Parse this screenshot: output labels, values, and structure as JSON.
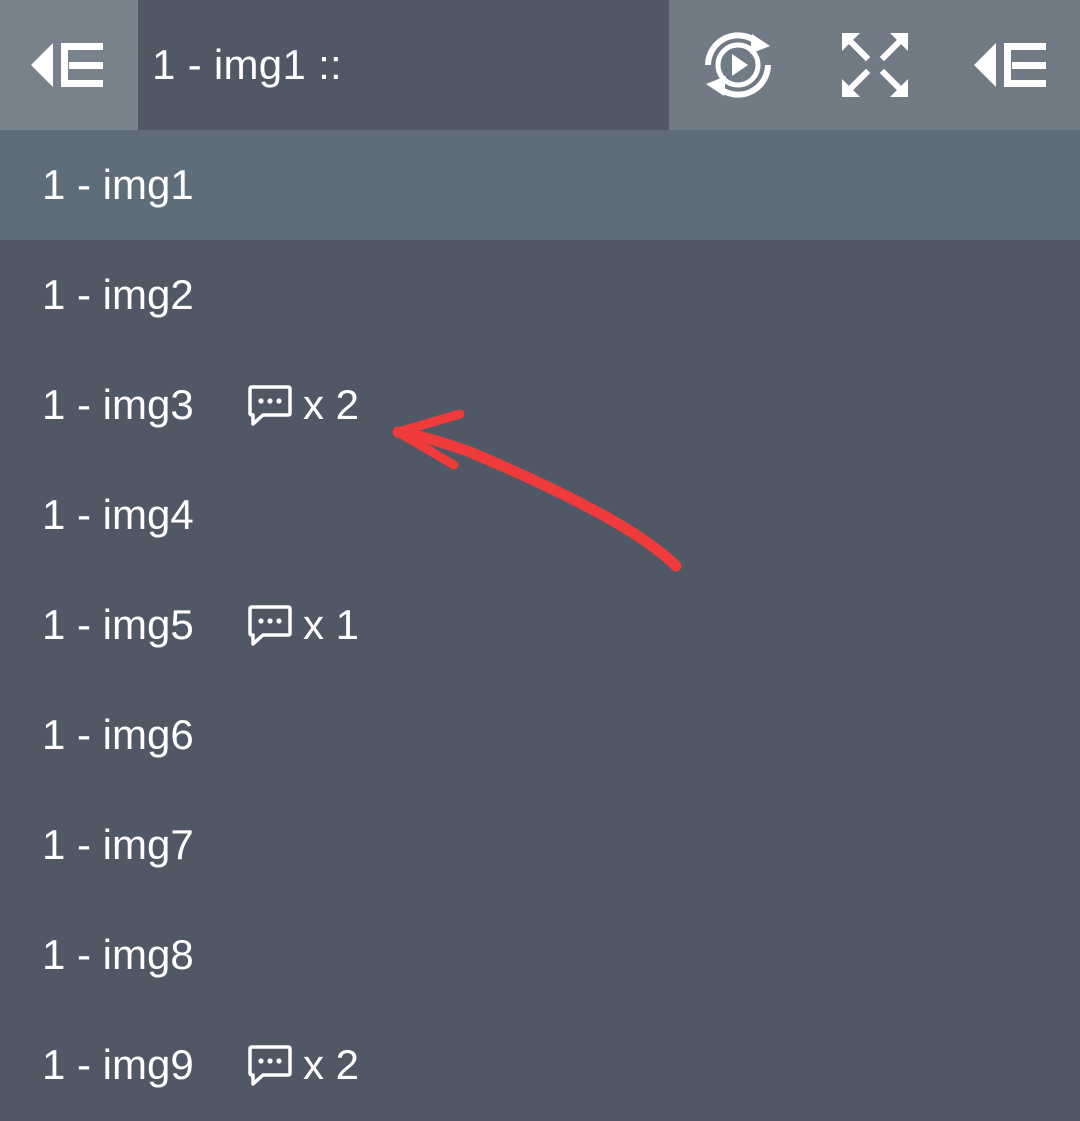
{
  "toolbar": {
    "collapse_left_icon": "collapse-sidebar-icon",
    "title": "1 - img1 ::",
    "slideshow_icon": "play-loop-icon",
    "fullscreen_icon": "fullscreen-icon",
    "collapse_right_icon": "collapse-sidebar-icon"
  },
  "colors": {
    "toolbar_bg": "#717b86",
    "title_bg": "#4f5864",
    "list_bg": "#4f5864",
    "selected_bg": "#5f6c7a",
    "text": "#ffffff",
    "annotation_arrow": "#ef3b3b"
  },
  "list": {
    "items": [
      {
        "label": "1 - img1",
        "comments": "",
        "selected": true
      },
      {
        "label": "1 - img2",
        "comments": ""
      },
      {
        "label": "1 - img3",
        "comments": "x 2",
        "comment_icon": "comment-icon"
      },
      {
        "label": "1 - img4",
        "comments": ""
      },
      {
        "label": "1 - img5",
        "comments": "x 1",
        "comment_icon": "comment-icon"
      },
      {
        "label": "1 - img6",
        "comments": ""
      },
      {
        "label": "1 - img7",
        "comments": ""
      },
      {
        "label": "1 - img8",
        "comments": ""
      },
      {
        "label": "1 - img9",
        "comments": "x 2",
        "comment_icon": "comment-icon"
      }
    ]
  }
}
